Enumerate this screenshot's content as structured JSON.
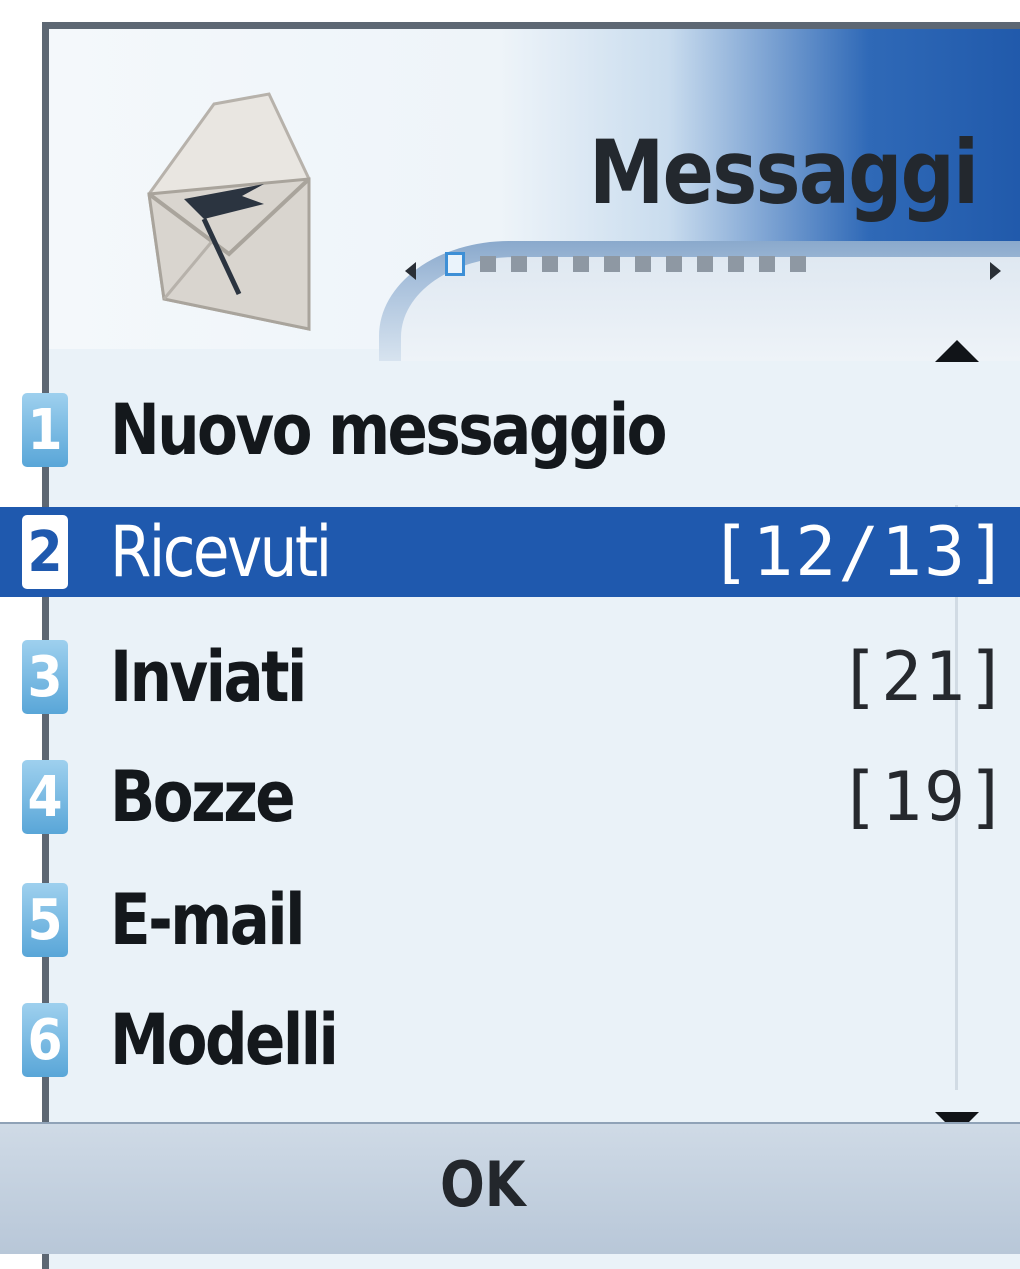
{
  "header": {
    "title": "Messaggi",
    "icon": "envelope-icon",
    "tab_indicator": {
      "total": 12,
      "active_index": 1
    }
  },
  "menu": {
    "items": [
      {
        "number": "1",
        "label": "Nuovo messaggio",
        "count": ""
      },
      {
        "number": "2",
        "label": "Ricevuti",
        "count": "[12/13]"
      },
      {
        "number": "3",
        "label": "Inviati",
        "count": "[21]"
      },
      {
        "number": "4",
        "label": "Bozze",
        "count": "[19]"
      },
      {
        "number": "5",
        "label": "E-mail",
        "count": ""
      },
      {
        "number": "6",
        "label": "Modelli",
        "count": ""
      }
    ],
    "selected_index": 2
  },
  "softkeys": {
    "center": "OK"
  },
  "colors": {
    "selection": "#1f59ae",
    "badge": "#59a6d8",
    "header_accent": "#2f69b7"
  }
}
